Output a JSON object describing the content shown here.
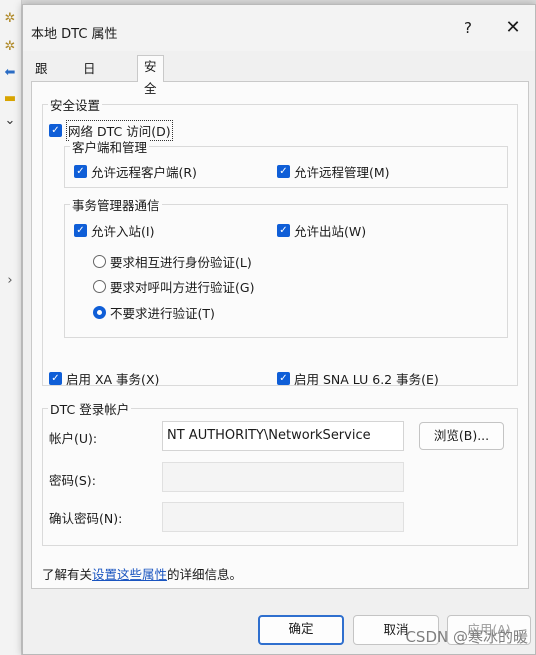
{
  "window": {
    "title": "本地 DTC 属性",
    "help": "?",
    "close": "✕"
  },
  "tabs": [
    "跟踪",
    "日志记录",
    "安全"
  ],
  "security": {
    "group_label": "安全设置",
    "network_dtc_access": "网络 DTC 访问(D)",
    "client_admin": {
      "label": "客户端和管理",
      "allow_remote_clients": "允许远程客户端(R)",
      "allow_remote_admin": "允许远程管理(M)"
    },
    "tm_comm": {
      "label": "事务管理器通信",
      "allow_inbound": "允许入站(I)",
      "allow_outbound": "允许出站(W)",
      "auth_options": [
        "要求相互进行身份验证(L)",
        "要求对呼叫方进行验证(G)",
        "不要求进行验证(T)"
      ],
      "selected_index": 2
    },
    "enable_xa": "启用 XA 事务(X)",
    "enable_sna": "启用 SNA LU 6.2 事务(E)"
  },
  "logon": {
    "group_label": "DTC 登录帐户",
    "account_label": "帐户(U):",
    "account_value": "NT AUTHORITY\\NetworkService",
    "browse": "浏览(B)...",
    "password_label": "密码(S):",
    "confirm_label": "确认密码(N):"
  },
  "info": {
    "prefix": "了解有关",
    "link": "设置这些属性",
    "suffix": "的详细信息。"
  },
  "buttons": {
    "ok": "确定",
    "cancel": "取消",
    "apply": "应用(A)"
  },
  "watermark": "CSDN @寒冰的暖",
  "colors": {
    "accent": "#0f5ed7",
    "link": "#1a55c0"
  },
  "icons": [
    "check-icon",
    "help-icon",
    "close-icon",
    "back-arrow-icon",
    "folder-icon",
    "chevron-down-icon",
    "chevron-right-icon"
  ]
}
